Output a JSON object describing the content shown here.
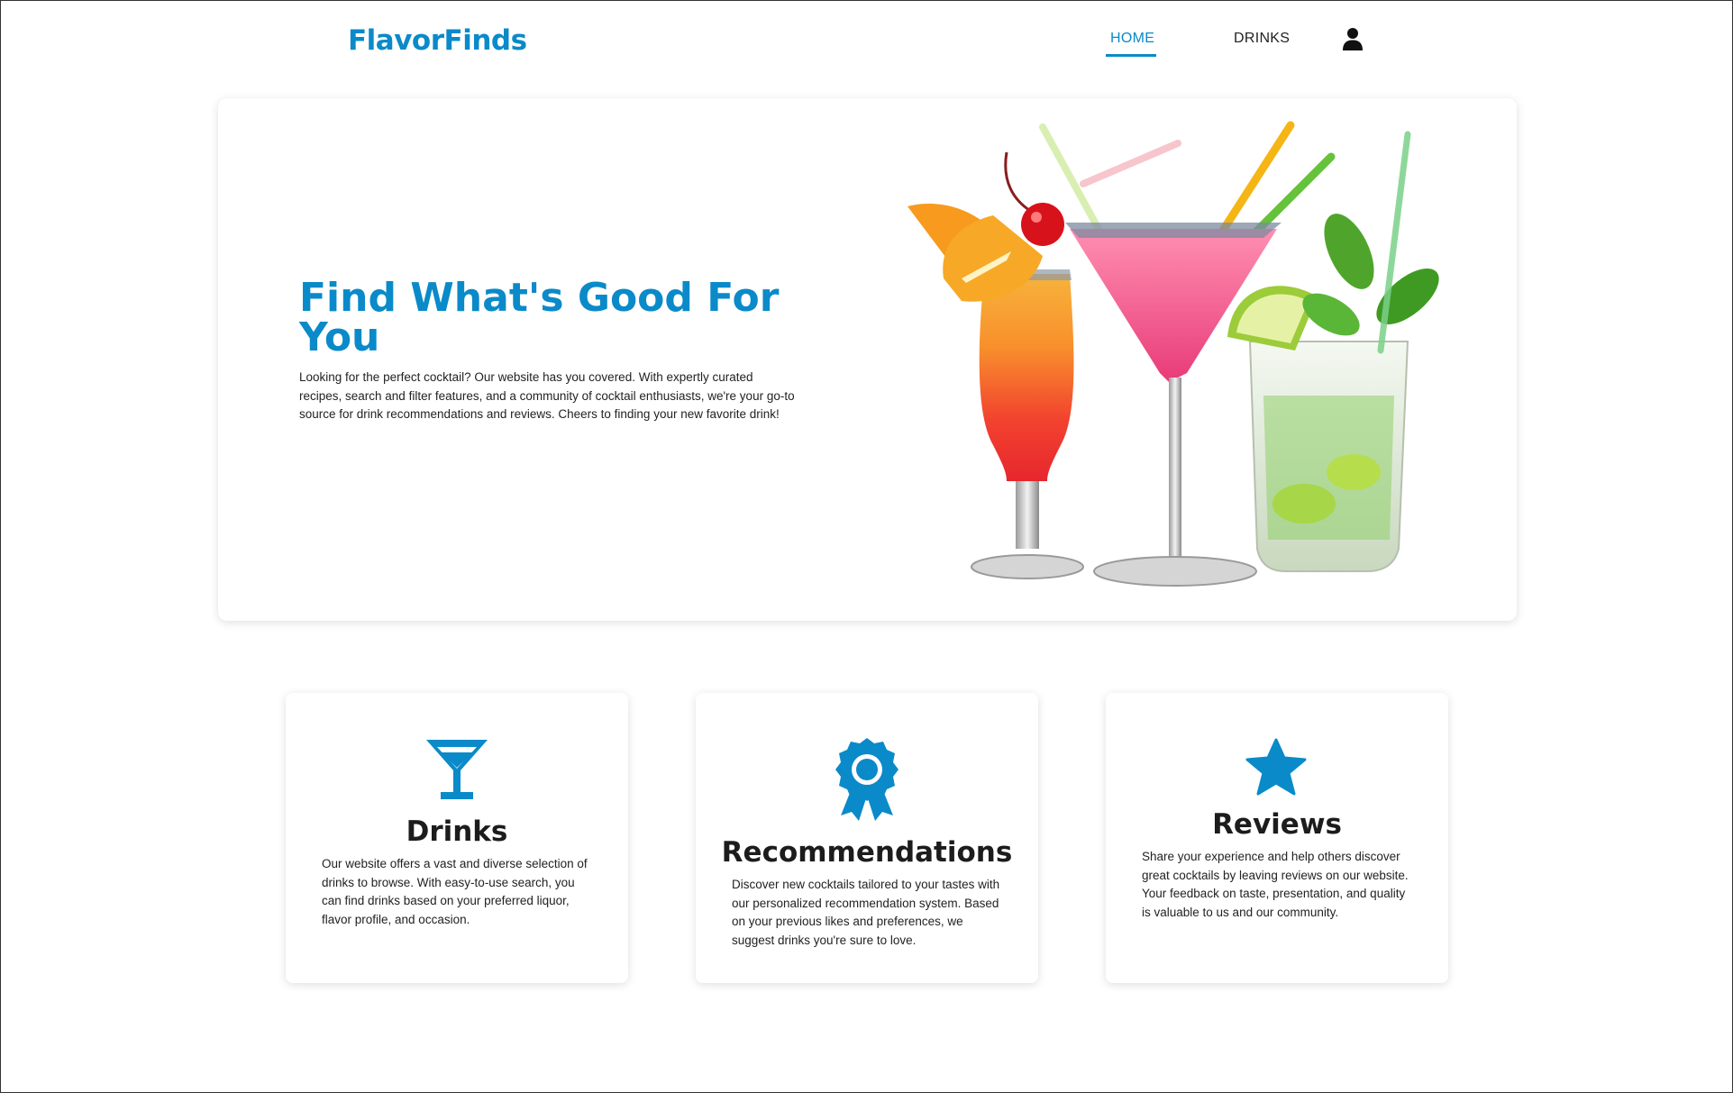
{
  "brand": {
    "name": "FlavorFinds",
    "color": "#0a8ac9"
  },
  "nav": {
    "items": [
      {
        "label": "HOME",
        "active": true
      },
      {
        "label": "DRINKS",
        "active": false
      }
    ],
    "user_icon": "user-icon"
  },
  "hero": {
    "title": "Find What's Good For You",
    "text": "Looking for the perfect cocktail? Our website has you covered. With expertly curated recipes, search and filter features, and a community of cocktail enthusiasts, we're your go-to source for drink recommendations and reviews. Cheers to finding your new favorite drink!",
    "image_icon": "cocktails-illustration"
  },
  "features": [
    {
      "icon": "martini-glass-icon",
      "title": "Drinks",
      "text": "Our website offers a vast and diverse selection of drinks to browse. With easy-to-use search, you can find drinks based on your preferred liquor, flavor profile, and occasion."
    },
    {
      "icon": "award-ribbon-icon",
      "title": "Recommendations",
      "text": "Discover new cocktails tailored to your tastes with our personalized recommendation system. Based on your previous likes and preferences, we suggest drinks you're sure to love."
    },
    {
      "icon": "star-icon",
      "title": "Reviews",
      "text": "Share your experience and help others discover great cocktails by leaving reviews on our website. Your feedback on taste, presentation, and quality is valuable to us and our community."
    }
  ],
  "colors": {
    "accent": "#0a8ac9",
    "text": "#222222",
    "background": "#ffffff"
  }
}
